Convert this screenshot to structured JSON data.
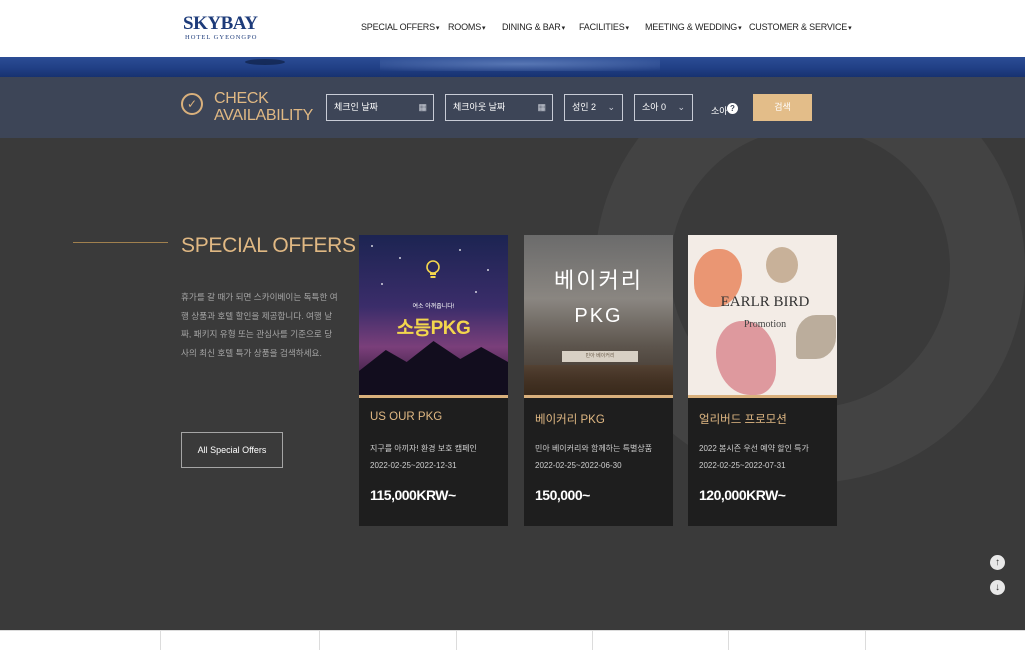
{
  "header": {
    "logo_main": "SKYBAY",
    "logo_sub": "HOTEL GYEONGPO",
    "nav": [
      {
        "label": "SPECIAL OFFERS"
      },
      {
        "label": "ROOMS"
      },
      {
        "label": "DINING & BAR"
      },
      {
        "label": "FACILITIES"
      },
      {
        "label": "MEETING & WEDDING"
      },
      {
        "label": "CUSTOMER & SERVICE"
      }
    ]
  },
  "booking": {
    "title_line1": "CHECK",
    "title_line2": "AVAILABILITY",
    "checkin_placeholder": "체크인 날짜",
    "checkout_placeholder": "체크아웃 날짜",
    "adults": "성인 2",
    "children": "소아 0",
    "child_label": "소아",
    "help": "?",
    "search_label": "검색"
  },
  "special_offers": {
    "title": "SPECIAL OFFERS",
    "description": "휴가를 갈 때가 되면 스카이베이는 독특한 여행 상품과 호텔 할인을 제공합니다. 여행 날짜, 패키지 유형 또는 관심사를 기준으로 당사의 최신 호텔 특가 상품을 검색하세요.",
    "all_button": "All Special Offers",
    "cards": [
      {
        "img_small": "여소 아껴줍니다!",
        "img_big": "소등PKG",
        "title": "US OUR PKG",
        "desc": "지구를 아끼자! 환경 보호 캠페인",
        "date": "2022-02-25~2022-12-31",
        "price": "115,000KRW~"
      },
      {
        "img_line1": "베이커리",
        "img_line2": "PKG",
        "img_tag": "민아 베이커리",
        "title": "베이커리 PKG",
        "desc": "민아 베이커리와 함께하는 특별상품",
        "date": "2022-02-25~2022-06-30",
        "price": "150,000~"
      },
      {
        "img_line1": "EARLR BIRD",
        "img_line2": "Promotion",
        "title": "얼리버드 프로모션",
        "desc": "2022 봄시즌 우선 예약 할인 특가",
        "date": "2022-02-25~2022-07-31",
        "price": "120,000KRW~"
      }
    ]
  },
  "scroll": {
    "up": "↑",
    "down": "↓"
  },
  "icons": {
    "check": "check-circle-icon",
    "calendar": "calendar-icon",
    "caret": "caret-down-icon",
    "question": "question-icon",
    "bulb": "lightbulb-icon"
  },
  "colors": {
    "accent": "#e0b883",
    "navy": "#1d3b7a",
    "booking_bg": "#3d4557",
    "main_bg": "#3a3a3a",
    "card_bg": "#1e1e1e",
    "search_btn": "#e3bd89"
  }
}
